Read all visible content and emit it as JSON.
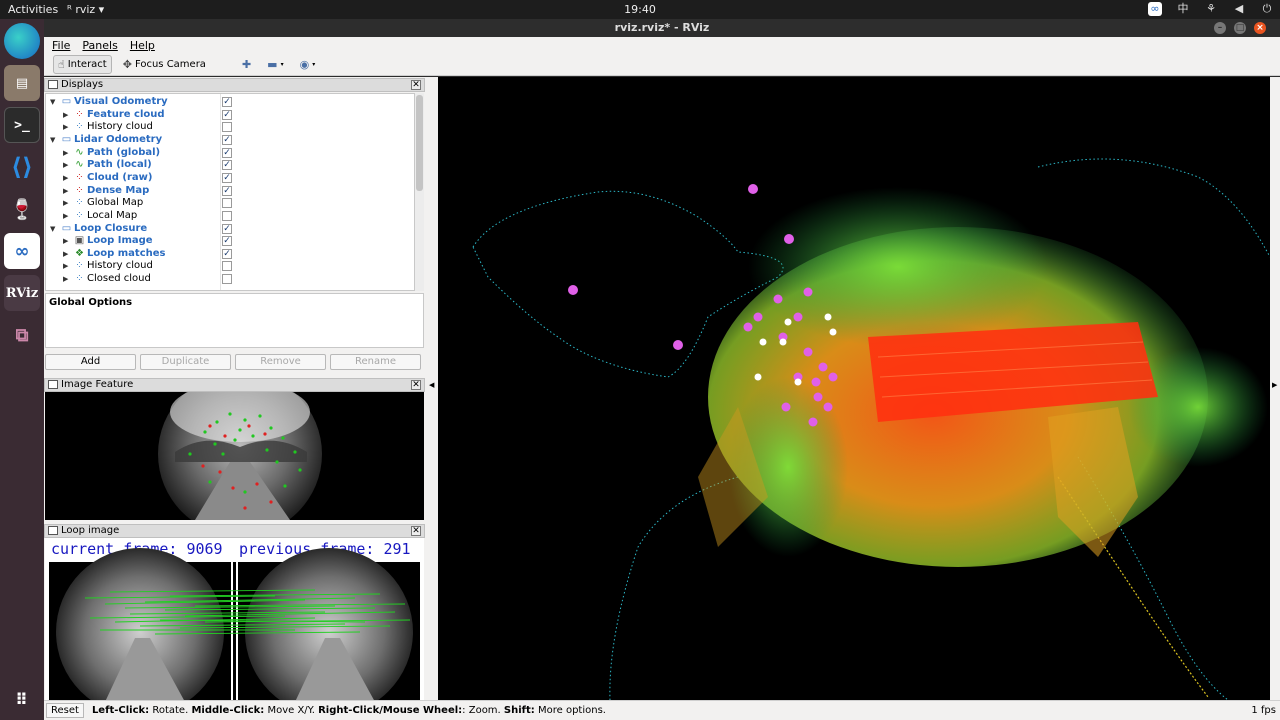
{
  "topbar": {
    "activities": "Activities",
    "app": "rviz",
    "clock": "19:40"
  },
  "window": {
    "title": "rviz.rviz* - RViz"
  },
  "menu": [
    "File",
    "Panels",
    "Help"
  ],
  "toolbar": {
    "interact": "Interact",
    "focus_camera": "Focus Camera"
  },
  "displays_panel": {
    "title": "Displays",
    "rows": [
      {
        "label": "Visual Odometry",
        "level": 0,
        "checked": true,
        "icon": "folder-icon"
      },
      {
        "label": "Feature cloud",
        "level": 1,
        "checked": true,
        "icon": "pointcloud-icon"
      },
      {
        "label": "History cloud",
        "level": 1,
        "checked": false,
        "icon": "pointcloud-icon"
      },
      {
        "label": "Lidar Odometry",
        "level": 0,
        "checked": true,
        "icon": "folder-icon"
      },
      {
        "label": "Path (global)",
        "level": 1,
        "checked": true,
        "icon": "path-icon"
      },
      {
        "label": "Path (local)",
        "level": 1,
        "checked": true,
        "icon": "path-icon"
      },
      {
        "label": "Cloud (raw)",
        "level": 1,
        "checked": true,
        "icon": "pointcloud-icon"
      },
      {
        "label": "Dense Map",
        "level": 1,
        "checked": true,
        "icon": "pointcloud-icon"
      },
      {
        "label": "Global Map",
        "level": 1,
        "checked": false,
        "icon": "pointcloud-icon"
      },
      {
        "label": "Local Map",
        "level": 1,
        "checked": false,
        "icon": "pointcloud-icon"
      },
      {
        "label": "Loop Closure",
        "level": 0,
        "checked": true,
        "icon": "folder-icon"
      },
      {
        "label": "Loop Image",
        "level": 1,
        "checked": true,
        "icon": "image-icon"
      },
      {
        "label": "Loop matches",
        "level": 1,
        "checked": true,
        "icon": "marker-icon"
      },
      {
        "label": "History cloud",
        "level": 1,
        "checked": false,
        "icon": "pointcloud-icon"
      },
      {
        "label": "Closed cloud",
        "level": 1,
        "checked": false,
        "icon": "pointcloud-icon"
      }
    ],
    "global_options": "Global Options",
    "buttons": {
      "add": "Add",
      "duplicate": "Duplicate",
      "remove": "Remove",
      "rename": "Rename"
    }
  },
  "image_feature_panel": {
    "title": "Image Feature"
  },
  "loop_image_panel": {
    "title": "Loop image",
    "current_frame": "current frame: 9069",
    "previous_frame": "previous frame: 291"
  },
  "statusbar": {
    "reset": "Reset",
    "hint_left_click": "Left-Click:",
    "hint_left_action": " Rotate. ",
    "hint_middle_click": "Middle-Click:",
    "hint_middle_action": " Move X/Y. ",
    "hint_right_click": "Right-Click/Mouse Wheel:",
    "hint_right_action": ": Zoom. ",
    "hint_shift": "Shift:",
    "hint_shift_action": " More options.",
    "fps": "1 fps"
  },
  "colors": {
    "accent_blue": "#2a6bc0",
    "map_red": "#ff3a10",
    "map_green": "#5fe040",
    "loop_magenta": "#e060e8"
  }
}
